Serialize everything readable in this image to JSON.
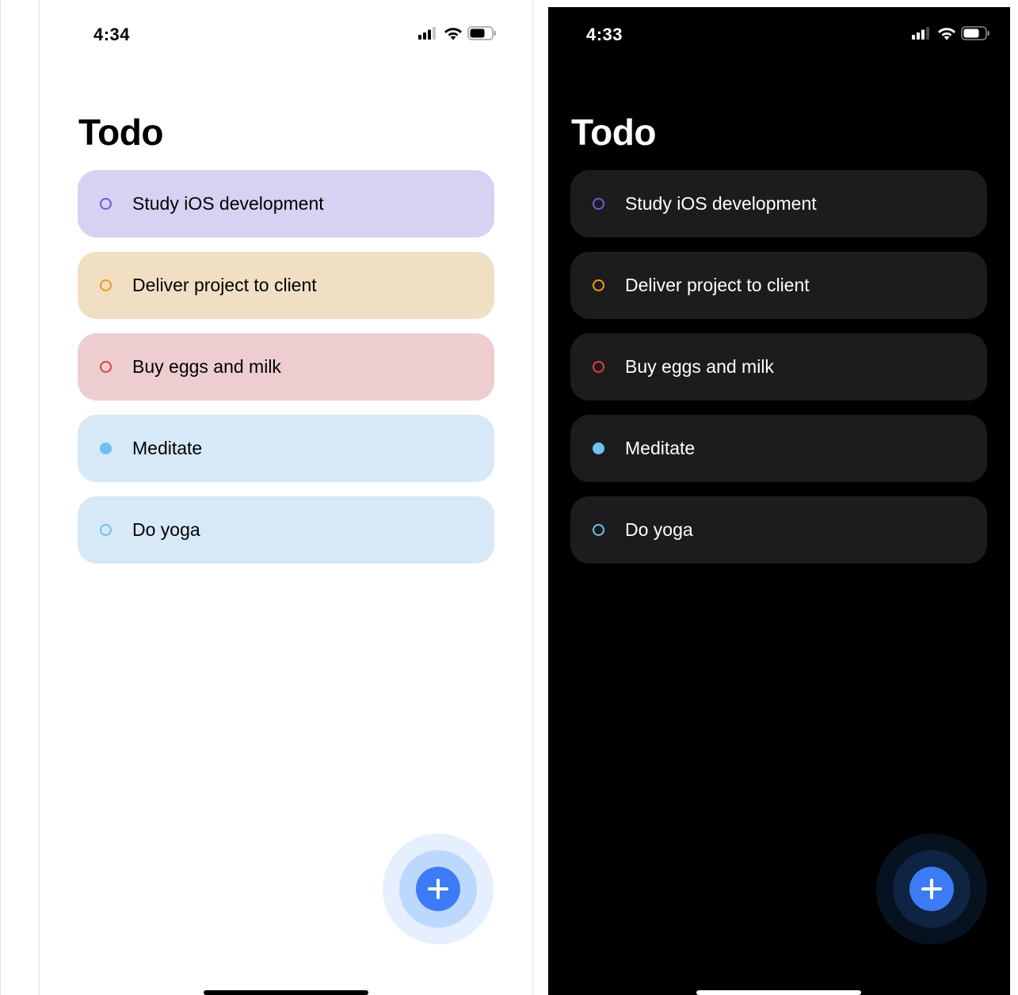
{
  "colors": {
    "accent_blue": "#3d7bf6",
    "purple": "#6a5cd6",
    "orange": "#f19a1d",
    "red": "#e0423b",
    "light_blue": "#6cc1f2"
  },
  "light": {
    "status": {
      "time": "4:34"
    },
    "title": "Todo",
    "todos": [
      {
        "label": "Study iOS development",
        "done": false,
        "color": "#6a5cd6",
        "bg": "#d5d2f2"
      },
      {
        "label": "Deliver project to client",
        "done": false,
        "color": "#f19a1d",
        "bg": "#f1dfc4"
      },
      {
        "label": "Buy eggs and milk",
        "done": false,
        "color": "#e0423b",
        "bg": "#eecdd0"
      },
      {
        "label": "Meditate",
        "done": true,
        "color": "#6cc1f2",
        "bg": "#d7e8f6"
      },
      {
        "label": "Do yoga",
        "done": false,
        "color": "#6cc1f2",
        "bg": "#d7e8f6"
      }
    ],
    "fab": {
      "icon": "plus-icon",
      "outer": "#e5effd",
      "mid": "#bdd8fd",
      "inner": "#3d7bf6"
    }
  },
  "dark": {
    "status": {
      "time": "4:33"
    },
    "title": "Todo",
    "todos": [
      {
        "label": "Study iOS development",
        "done": false,
        "color": "#6a5cd6"
      },
      {
        "label": "Deliver project to client",
        "done": false,
        "color": "#f19a1d"
      },
      {
        "label": "Buy eggs and milk",
        "done": false,
        "color": "#e0423b"
      },
      {
        "label": "Meditate",
        "done": true,
        "color": "#6cc1f2"
      },
      {
        "label": "Do yoga",
        "done": false,
        "color": "#6cc1f2"
      }
    ],
    "fab": {
      "icon": "plus-icon",
      "outer": "#071221",
      "mid": "#0f2442",
      "inner": "#3d7bf6"
    }
  }
}
